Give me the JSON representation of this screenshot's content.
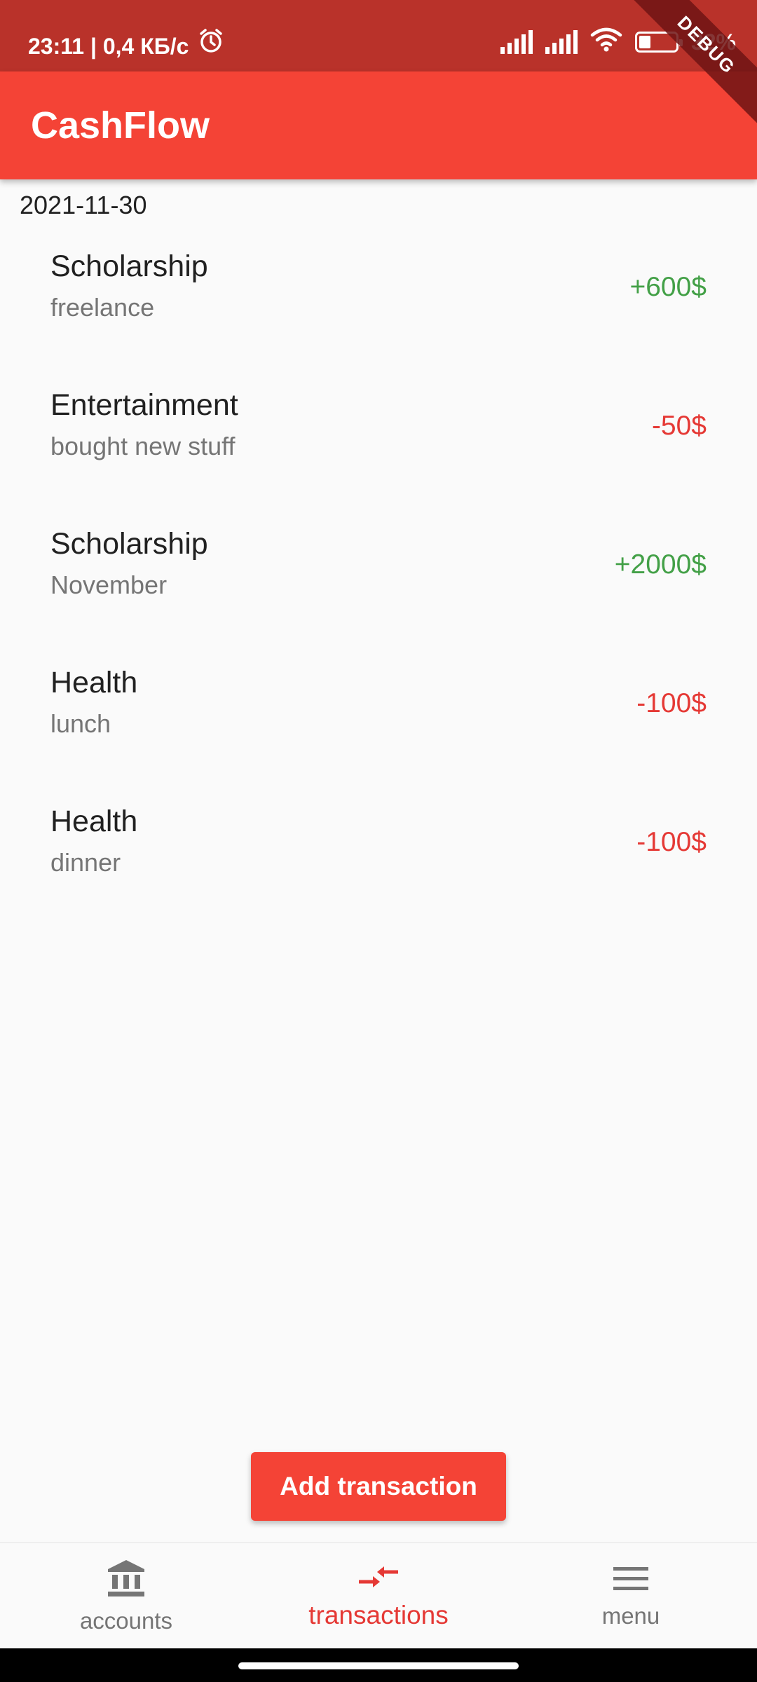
{
  "status_bar": {
    "time_speed": "23:11 | 0,4 КБ/с",
    "battery_percent": "32%",
    "battery_level": 0.32,
    "debug_banner": "DEBUG"
  },
  "app_bar": {
    "title": "CashFlow"
  },
  "transactions": {
    "date": "2021-11-30",
    "items": [
      {
        "category": "Scholarship",
        "note": "freelance",
        "amount": "+600$",
        "type": "income"
      },
      {
        "category": "Entertainment",
        "note": "bought new stuff",
        "amount": "-50$",
        "type": "expense"
      },
      {
        "category": "Scholarship",
        "note": "November",
        "amount": "+2000$",
        "type": "income"
      },
      {
        "category": "Health",
        "note": "lunch",
        "amount": "-100$",
        "type": "expense"
      },
      {
        "category": "Health",
        "note": "dinner",
        "amount": "-100$",
        "type": "expense"
      }
    ]
  },
  "actions": {
    "add_transaction": "Add transaction"
  },
  "bottom_nav": {
    "items": [
      {
        "label": "accounts",
        "icon": "bank-icon",
        "active": false
      },
      {
        "label": "transactions",
        "icon": "compare-arrows-icon",
        "active": true
      },
      {
        "label": "menu",
        "icon": "menu-icon",
        "active": false
      }
    ]
  },
  "colors": {
    "primary": "#f44336",
    "status_bar": "#b9322a",
    "income": "#43a047",
    "expense": "#e53935"
  }
}
